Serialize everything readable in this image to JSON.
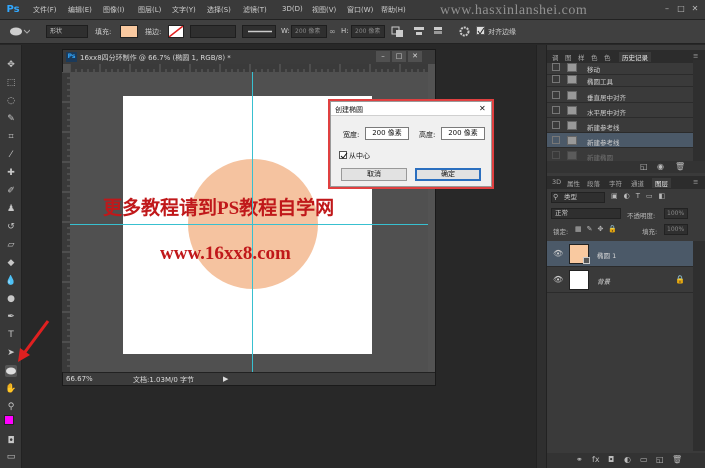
{
  "app": {
    "logo": "Ps"
  },
  "menu": [
    "文件(F)",
    "编辑(E)",
    "图像(I)",
    "图层(L)",
    "文字(Y)",
    "选择(S)",
    "滤镜(T)",
    "3D(D)",
    "视图(V)",
    "窗口(W)",
    "帮助(H)"
  ],
  "watermark": "www.hasxinlanshei.com",
  "options_bar": {
    "fill_label": "填充:",
    "stroke_label": "描边:",
    "w_label": "W:",
    "h_label": "H:",
    "w_value": "200 像素",
    "h_value": "200 像素",
    "align_edges_label": "对齐边缘",
    "shape_mode": "形状",
    "fill_color": "#f9c9a0"
  },
  "document": {
    "title": "16xx8四分环制作 @ 66.7% (椭圆 1, RGB/8) *",
    "zoom": "66.67%",
    "status": "文档:1.03M/0 字节",
    "overlay_heading": "更多教程请到PS教程自学网",
    "overlay_url": "www.16xx8.com",
    "circle_color": "#f5c3a0",
    "overlay_color": "#c0181a"
  },
  "dialog": {
    "title": "创建椭圆",
    "width_label": "宽度:",
    "width_value": "200 像素",
    "height_label": "高度:",
    "height_value": "200 像素",
    "from_center_label": "从中心",
    "cancel_label": "取消",
    "ok_label": "确定"
  },
  "history_panel": {
    "tabs": [
      "调",
      "图",
      "样",
      "色",
      "色",
      "历史记录"
    ],
    "items": [
      "移动",
      "椭圆工具",
      "垂直居中对齐",
      "水平居中对齐",
      "新建参考线",
      "新建参考线",
      "新建椭圆"
    ]
  },
  "layers_panel": {
    "tabs": [
      "3D",
      "属性",
      "段落",
      "字符",
      "通道",
      "图层"
    ],
    "filter_label": "类型",
    "blend_mode": "正常",
    "opacity_label": "不透明度:",
    "opacity_value": "100%",
    "lock_label": "锁定:",
    "fill_label": "填充:",
    "fill_value": "100%",
    "layers": [
      {
        "name": "椭圆 1",
        "thumb_color": "#f9c9a0"
      },
      {
        "name": "背景",
        "thumb_color": "#ffffff"
      }
    ]
  },
  "colors": {
    "foreground": "#ff00ff",
    "background": "#ffffff",
    "arrow": "#e02020",
    "guide": "#38c0d0"
  }
}
